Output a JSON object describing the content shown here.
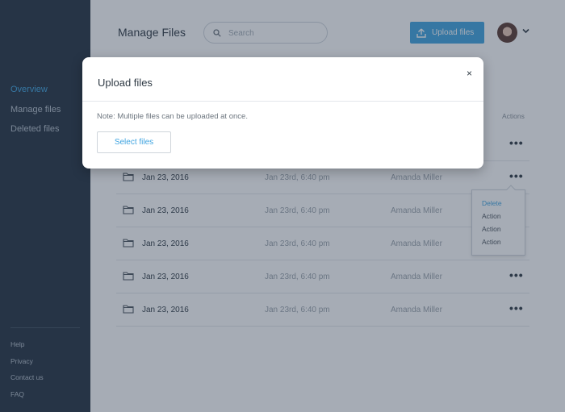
{
  "sidebar": {
    "nav": [
      {
        "label": "Overview",
        "active": true
      },
      {
        "label": "Manage files",
        "active": false
      },
      {
        "label": "Deleted files",
        "active": false
      }
    ],
    "footer": [
      "Help",
      "Privacy",
      "Contact us",
      "FAQ"
    ]
  },
  "header": {
    "title": "Manage Files",
    "search_placeholder": "Search",
    "search_icon": "search-icon",
    "upload_label": "Upload files",
    "upload_icon": "upload-icon",
    "avatar_caret_icon": "chevron-down-icon"
  },
  "table": {
    "actions_header": "Actions",
    "rows": [
      {
        "name": "Jan 23, 2016",
        "date": "Jan 23rd, 6:40 pm",
        "owner": "Amanda Miller"
      },
      {
        "name": "Jan 23, 2016",
        "date": "Jan 23rd, 6:40 pm",
        "owner": "Amanda Miller"
      },
      {
        "name": "Jan 23, 2016",
        "date": "Jan 23rd, 6:40 pm",
        "owner": "Amanda Miller"
      },
      {
        "name": "Jan 23, 2016",
        "date": "Jan 23rd, 6:40 pm",
        "owner": "Amanda Miller"
      },
      {
        "name": "Jan 23, 2016",
        "date": "Jan 23rd, 6:40 pm",
        "owner": "Amanda Miller"
      }
    ],
    "more_glyph": "•••"
  },
  "dropdown": {
    "items": [
      "Delete",
      "Action",
      "Action",
      "Action"
    ]
  },
  "modal": {
    "title": "Upload files",
    "close_glyph": "×",
    "note": "Note: Multiple files can be uploaded at once.",
    "select_label": "Select files"
  },
  "colors": {
    "accent": "#3fa4e0",
    "sidebar": "#233140"
  }
}
